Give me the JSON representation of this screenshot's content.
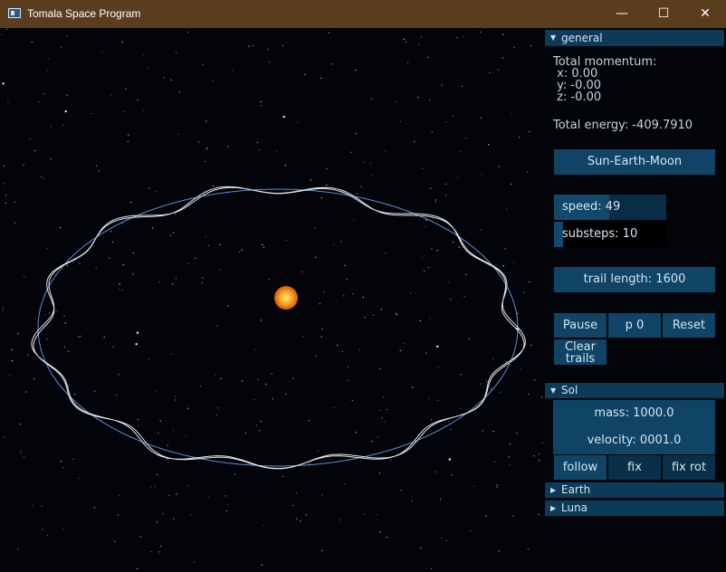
{
  "window": {
    "title": "Tomala Space Program",
    "minimize_glyph": "—",
    "maximize_glyph": "☐",
    "close_glyph": "✕",
    "icon": "app-window-icon"
  },
  "general": {
    "header": "general",
    "momentum_label": "Total momentum:",
    "momentum_x": " x: 0.00",
    "momentum_y": " y: -0.00",
    "momentum_z": " z: -0.00",
    "energy": "Total energy: -409.7910",
    "preset_button": "Sun-Earth-Moon",
    "speed": {
      "label": "speed: 49",
      "fraction": 0.49
    },
    "substeps": {
      "label": "substeps: 10",
      "fraction": 0.08
    },
    "trail_length": "trail length: 1600",
    "pause_button": "Pause",
    "p_button": "p 0",
    "reset_button": "Reset",
    "clear_trails_line1": "Clear",
    "clear_trails_line2": "trails"
  },
  "bodies": [
    {
      "header": "Sol",
      "expanded": true,
      "mass": "mass: 1000.0",
      "velocity": "velocity: 0001.0",
      "follow_button": "follow",
      "fix_button": "fix",
      "fix_rot_button": "fix rot"
    },
    {
      "header": "Earth",
      "expanded": false
    },
    {
      "header": "Luna",
      "expanded": false
    }
  ],
  "colors": {
    "panel_header": "#0c3b5a",
    "button": "#0f4466",
    "orbit_ellipse": "#5b8fd6",
    "trail": "#e6e6e6",
    "sun": "#f2a21c",
    "titlebar": "#5a3d1f"
  }
}
